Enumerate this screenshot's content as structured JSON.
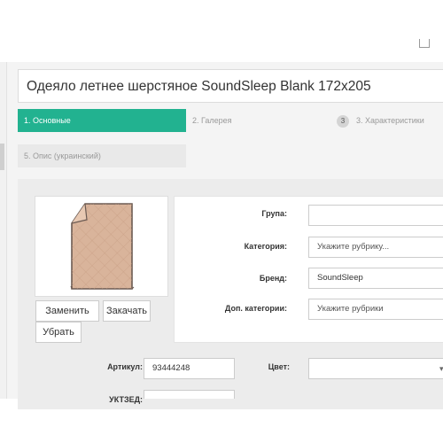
{
  "title": "Одеяло летнее шерстяное SoundSleep Blank 172x205",
  "tabs": {
    "main": "1. Основные",
    "gallery": "2. Галерея",
    "characteristics_badge": "3",
    "characteristics": "3. Характеристики",
    "description_ua": "5. Опис (украинский)"
  },
  "image_buttons": {
    "replace": "Заменить",
    "download": "Закачать",
    "remove": "Убрать"
  },
  "form": {
    "group_label": "Група:",
    "group_value": "",
    "category_label": "Категория:",
    "category_placeholder": "Укажите рубрику...",
    "brand_label": "Бренд:",
    "brand_value": "SoundSleep",
    "extra_categories_label": "Доп. категории:",
    "extra_categories_placeholder": "Укажите рубрики",
    "article_label": "Артикул:",
    "article_value": "93444248",
    "color_label": "Цвет:",
    "color_value": "",
    "uktzed_label": "УКТЗЕД:"
  },
  "colors": {
    "accent": "#22b290",
    "blanket": "#d9b49b",
    "blanket_piping": "#6b5a52"
  }
}
